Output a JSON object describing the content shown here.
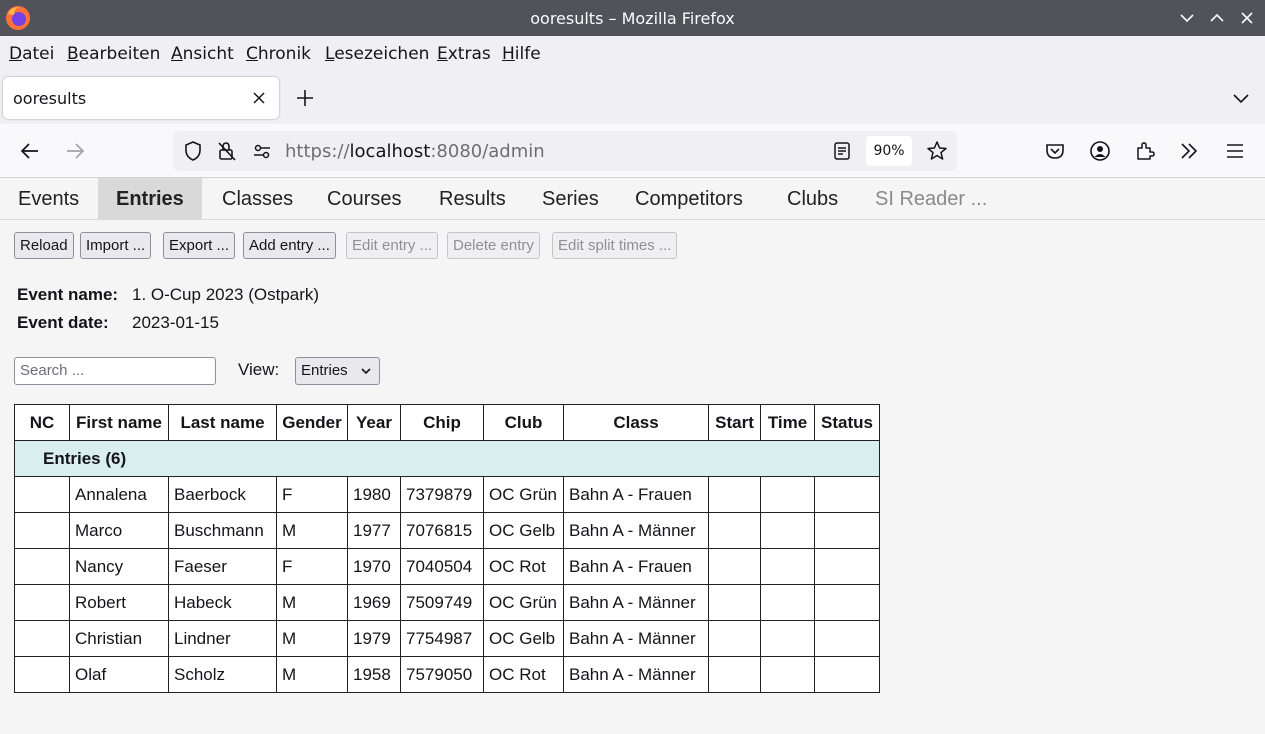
{
  "window": {
    "title": "ooresults – Mozilla Firefox"
  },
  "menu": {
    "items": [
      "Datei",
      "Bearbeiten",
      "Ansicht",
      "Chronik",
      "Lesezeichen",
      "Extras",
      "Hilfe"
    ]
  },
  "browser": {
    "tab_title": "ooresults",
    "url_scheme": "https://",
    "url_host": "localhost",
    "url_rest": ":8080/admin",
    "zoom": "90%"
  },
  "app": {
    "tabs": [
      {
        "label": "Events",
        "state": "normal"
      },
      {
        "label": "Entries",
        "state": "active"
      },
      {
        "label": "Classes",
        "state": "normal"
      },
      {
        "label": "Courses",
        "state": "normal"
      },
      {
        "label": "Results",
        "state": "normal"
      },
      {
        "label": "Series",
        "state": "normal"
      },
      {
        "label": "Competitors",
        "state": "normal"
      },
      {
        "label": "Clubs",
        "state": "normal"
      },
      {
        "label": "SI Reader ...",
        "state": "disabled"
      }
    ],
    "toolbar": {
      "reload": "Reload",
      "import": "Import ...",
      "export": "Export ...",
      "add_entry": "Add entry ...",
      "edit_entry": "Edit entry ...",
      "delete_entry": "Delete entry",
      "edit_split_times": "Edit split times ..."
    },
    "event": {
      "name_label": "Event name:",
      "name_value": "1. O-Cup 2023 (Ostpark)",
      "date_label": "Event date:",
      "date_value": "2023-01-15"
    },
    "search_placeholder": "Search ...",
    "view_label": "View:",
    "view_selected": "Entries",
    "table": {
      "headers": [
        "NC",
        "First name",
        "Last name",
        "Gender",
        "Year",
        "Chip",
        "Club",
        "Class",
        "Start",
        "Time",
        "Status"
      ],
      "group_label": "Entries  (6)",
      "rows": [
        [
          "",
          "Annalena",
          "Baerbock",
          "F",
          "1980",
          "7379879",
          "OC Grün",
          "Bahn A - Frauen",
          "",
          "",
          ""
        ],
        [
          "",
          "Marco",
          "Buschmann",
          "M",
          "1977",
          "7076815",
          "OC Gelb",
          "Bahn A - Männer",
          "",
          "",
          ""
        ],
        [
          "",
          "Nancy",
          "Faeser",
          "F",
          "1970",
          "7040504",
          "OC Rot",
          "Bahn A - Frauen",
          "",
          "",
          ""
        ],
        [
          "",
          "Robert",
          "Habeck",
          "M",
          "1969",
          "7509749",
          "OC Grün",
          "Bahn A - Männer",
          "",
          "",
          ""
        ],
        [
          "",
          "Christian",
          "Lindner",
          "M",
          "1979",
          "7754987",
          "OC Gelb",
          "Bahn A - Männer",
          "",
          "",
          ""
        ],
        [
          "",
          "Olaf",
          "Scholz",
          "M",
          "1958",
          "7579050",
          "OC Rot",
          "Bahn A - Männer",
          "",
          "",
          ""
        ]
      ]
    }
  },
  "colors": {
    "titlebar": "#52535a",
    "active_tab": "#d9d9d9",
    "group_row": "#d9eeee"
  }
}
